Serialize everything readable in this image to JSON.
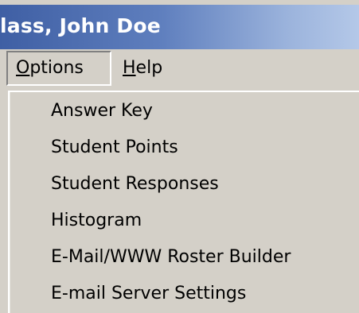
{
  "window": {
    "title": "lass, John Doe"
  },
  "menubar": {
    "options_label_u": "O",
    "options_label_rest": "ptions",
    "help_label_u": "H",
    "help_label_rest": "elp"
  },
  "options_menu": {
    "items": [
      {
        "label": "Answer Key"
      },
      {
        "label": "Student Points"
      },
      {
        "label": "Student Responses"
      },
      {
        "label": "Histogram"
      },
      {
        "label": "E-Mail/WWW Roster Builder"
      },
      {
        "label": "E-mail Server Settings"
      }
    ]
  },
  "colors": {
    "title_bar_start": "#3f5fa4",
    "title_bar_end": "#b4c8e8",
    "menu_background": "#d4d0c8"
  }
}
